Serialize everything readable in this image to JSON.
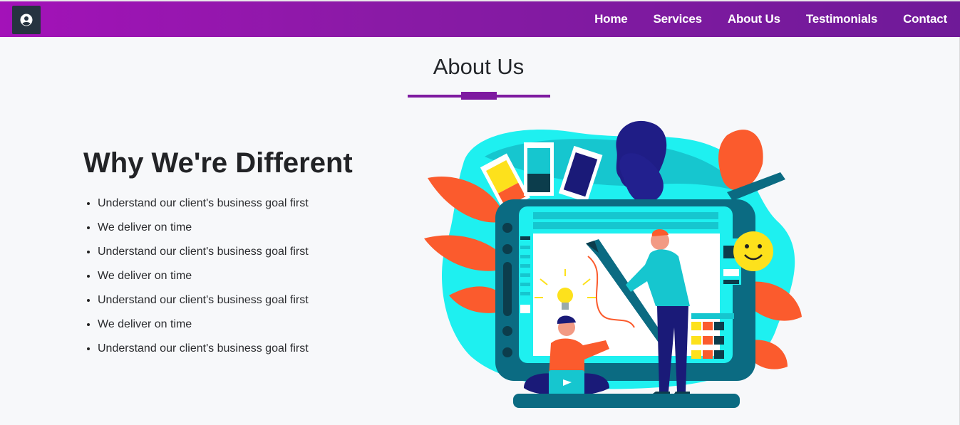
{
  "header": {
    "logo_icon": "user-circle-icon",
    "nav": [
      {
        "label": "Home"
      },
      {
        "label": "Services"
      },
      {
        "label": "About Us"
      },
      {
        "label": "Testimonials"
      },
      {
        "label": "Contact"
      }
    ],
    "gradient_colors": [
      "#a312b8",
      "#6f1a98"
    ]
  },
  "about": {
    "title": "About Us",
    "accent_color": "#7e1aa0",
    "heading": "Why We're Different",
    "points": [
      "Understand our client's business goal first",
      "We deliver on time",
      "Understand our client's business goal first",
      "We deliver on time",
      "Understand our client's business goal first",
      "We deliver on time",
      "Understand our client's business goal first"
    ],
    "illustration": "designer-team-illustration"
  }
}
